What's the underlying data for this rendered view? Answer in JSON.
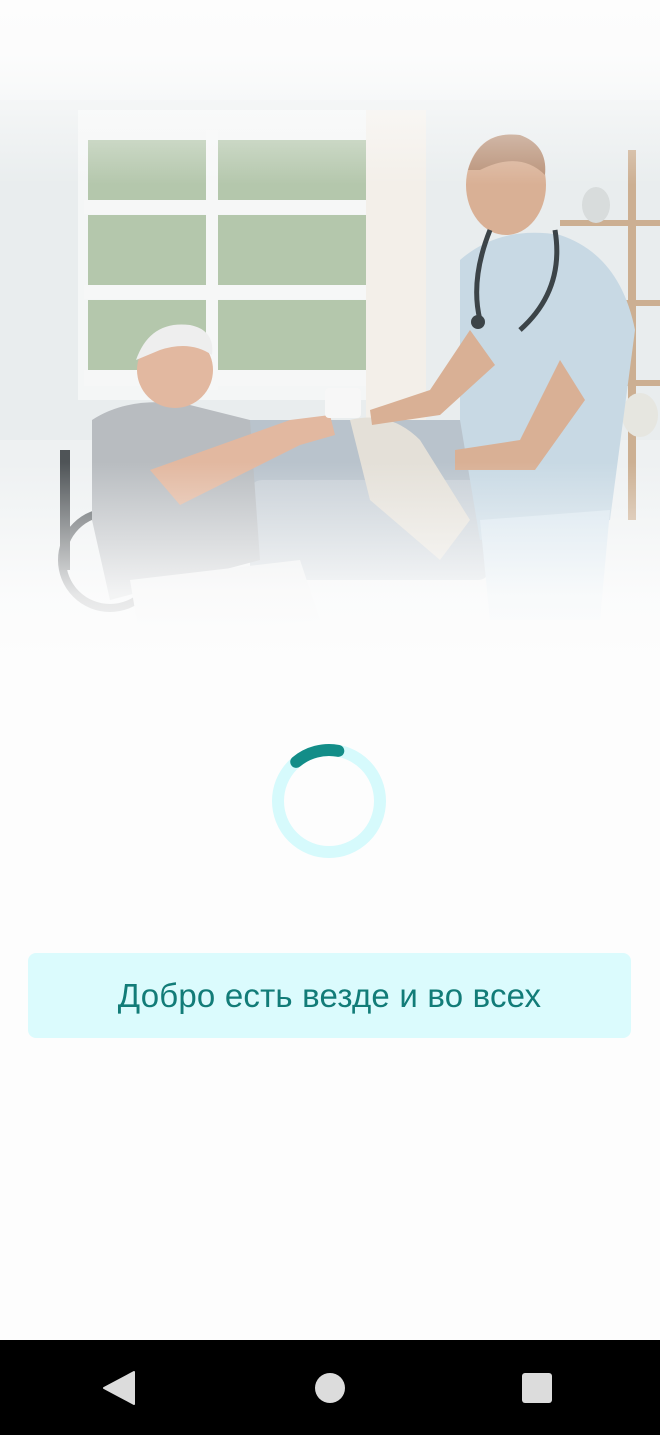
{
  "loading": {
    "message": "Добро есть везде и во всех",
    "spinner_progress": 0.14
  },
  "hero": {
    "illustration": "caregiver-handing-cup-to-elderly-man"
  },
  "nav_bar": {
    "back_icon": "back-triangle-icon",
    "home_icon": "home-circle-icon",
    "recents_icon": "recents-square-icon"
  },
  "colors": {
    "accent": "#138d88",
    "accent_light": "#dbfbfd",
    "text": "#127c78",
    "background": "#fdfdfd"
  }
}
